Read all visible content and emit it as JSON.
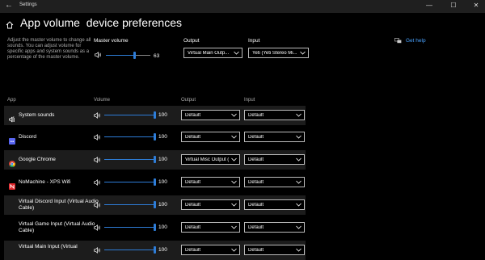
{
  "window": {
    "title": "Settings",
    "back_glyph": "←",
    "minimize_glyph": "—",
    "maximize_glyph": "☐",
    "close_glyph": "✕"
  },
  "header": {
    "title": "App volume  device preferences",
    "description": "Adjust the master volume to change all sounds. You can adjust volume for specific apps and system sounds as a percentage of the master volume."
  },
  "master": {
    "label": "Master volume",
    "value": "63",
    "level": 0.63,
    "output_label": "Output",
    "output_value": "Virtual Main Outp...",
    "input_label": "Input",
    "input_value": "Yeti (Yeti Stereo Mi..."
  },
  "help": {
    "label": "Get help"
  },
  "table": {
    "headers": {
      "app": "App",
      "volume": "Volume",
      "output": "Output",
      "input": "Input"
    },
    "rows": [
      {
        "name": "System sounds",
        "volume": "100",
        "output": "Default",
        "input": "Default",
        "icon": "system-sounds-icon"
      },
      {
        "name": "Discord",
        "volume": "100",
        "output": "Default",
        "input": "Default",
        "icon": "discord-icon"
      },
      {
        "name": "Google Chrome",
        "volume": "100",
        "output": "Virtual Misc Output (",
        "input": "Default",
        "icon": "chrome-icon"
      },
      {
        "name": "NoMachine - XPS Wifi",
        "volume": "100",
        "output": "Default",
        "input": "Default",
        "icon": "nomachine-icon"
      },
      {
        "name": "Virtual Discord Input (Virtual Audio Cable)",
        "volume": "100",
        "output": "Default",
        "input": "Default",
        "icon": ""
      },
      {
        "name": "Virtual Game Input (Virtual Audio Cable)",
        "volume": "100",
        "output": "Default",
        "input": "Default",
        "icon": ""
      },
      {
        "name": "Virtual Main Input (Virtual",
        "volume": "100",
        "output": "Default",
        "input": "Default",
        "icon": ""
      }
    ]
  },
  "colors": {
    "accent": "#2e7dd8",
    "link": "#4aa3ff",
    "row_bg": "#1c1c1c"
  }
}
